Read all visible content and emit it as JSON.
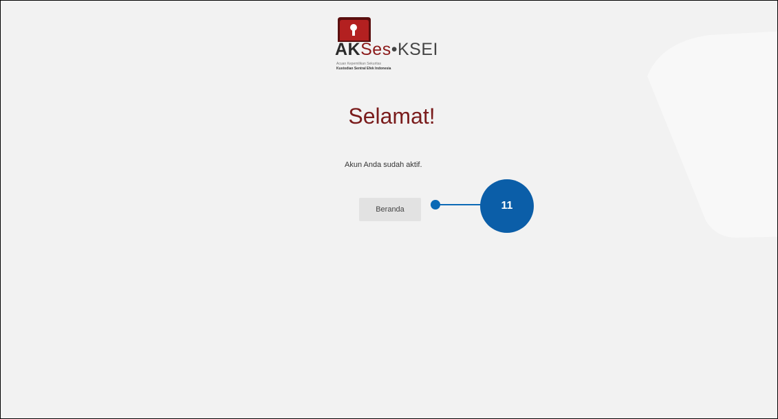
{
  "brand": {
    "logo_text_ak": "AK",
    "logo_text_ses": "Ses",
    "logo_text_dot": "•",
    "logo_text_ksei": "KSEI",
    "logo_subtitle": "Acuan Kepemilikan Sekuritas",
    "logo_subtitle2": "Kustodian Sentral Efek Indonesia",
    "colors": {
      "primary": "#8b1a1a",
      "callout": "#0b5ea8"
    }
  },
  "main": {
    "title": "Selamat!",
    "message": "Akun Anda sudah aktif.",
    "home_button_label": "Beranda"
  },
  "annotation": {
    "step_number": "11"
  }
}
